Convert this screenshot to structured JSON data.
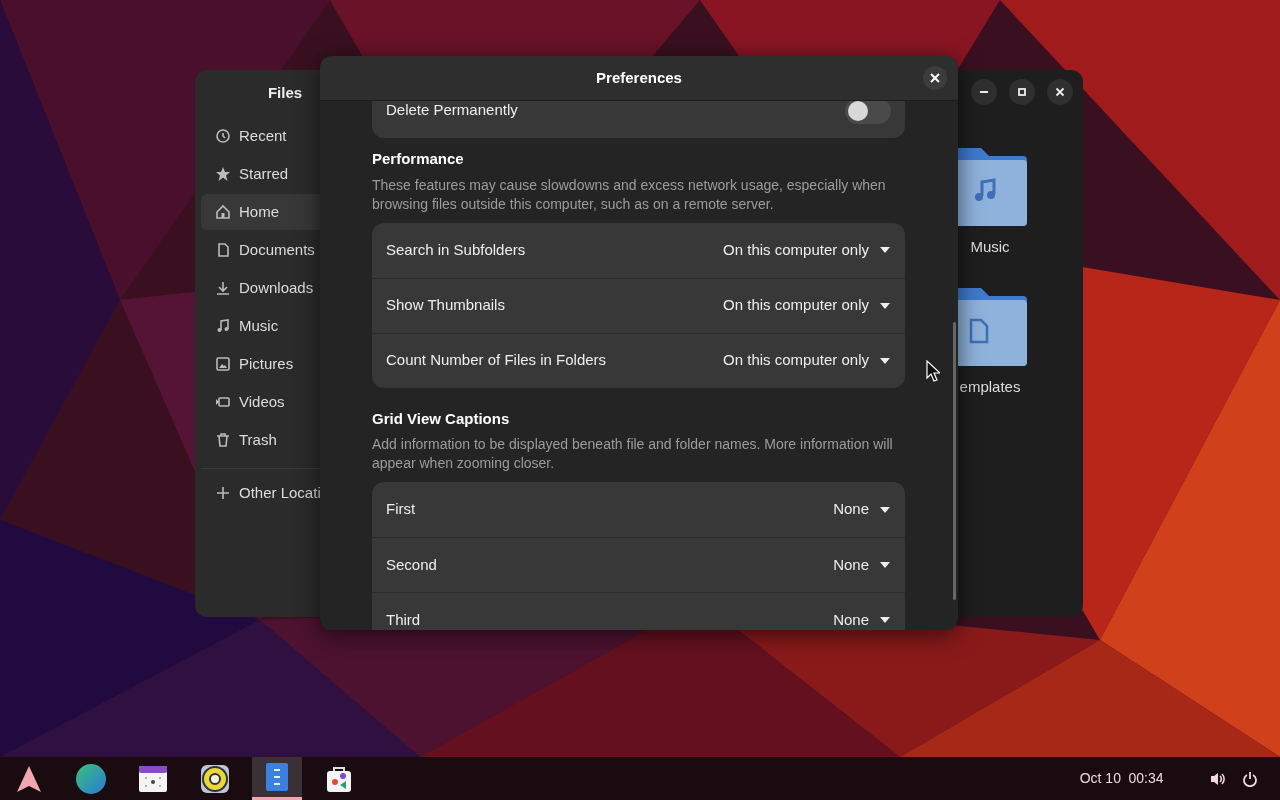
{
  "files_window": {
    "title": "Files",
    "sidebar": {
      "items": [
        {
          "label": "Recent",
          "selected": false
        },
        {
          "label": "Starred",
          "selected": false
        },
        {
          "label": "Home",
          "selected": true
        },
        {
          "label": "Documents",
          "selected": false
        },
        {
          "label": "Downloads",
          "selected": false
        },
        {
          "label": "Music",
          "selected": false
        },
        {
          "label": "Pictures",
          "selected": false
        },
        {
          "label": "Videos",
          "selected": false
        },
        {
          "label": "Trash",
          "selected": false
        }
      ],
      "other_locations": "Other Locati"
    },
    "folders": [
      {
        "label": "Music"
      },
      {
        "label": "emplates"
      }
    ]
  },
  "dialog": {
    "title": "Preferences",
    "top_row": {
      "label": "Delete Permanently",
      "on": false
    },
    "sections": [
      {
        "title": "Performance",
        "description": "These features may cause slowdowns and excess network usage, especially when browsing files outside this computer, such as on a remote server.",
        "rows": [
          {
            "label": "Search in Subfolders",
            "value": "On this computer only"
          },
          {
            "label": "Show Thumbnails",
            "value": "On this computer only"
          },
          {
            "label": "Count Number of Files in Folders",
            "value": "On this computer only"
          }
        ]
      },
      {
        "title": "Grid View Captions",
        "description": "Add information to be displayed beneath file and folder names. More information will appear when zooming closer.",
        "rows": [
          {
            "label": "First",
            "value": "None"
          },
          {
            "label": "Second",
            "value": "None"
          },
          {
            "label": "Third",
            "value": "None"
          }
        ]
      }
    ]
  },
  "taskbar": {
    "apps": [
      {
        "selected": false
      },
      {
        "selected": false
      },
      {
        "selected": false
      },
      {
        "selected": false
      },
      {
        "selected": true
      },
      {
        "selected": false
      }
    ],
    "date": "Oct 10",
    "time": "00:34"
  }
}
